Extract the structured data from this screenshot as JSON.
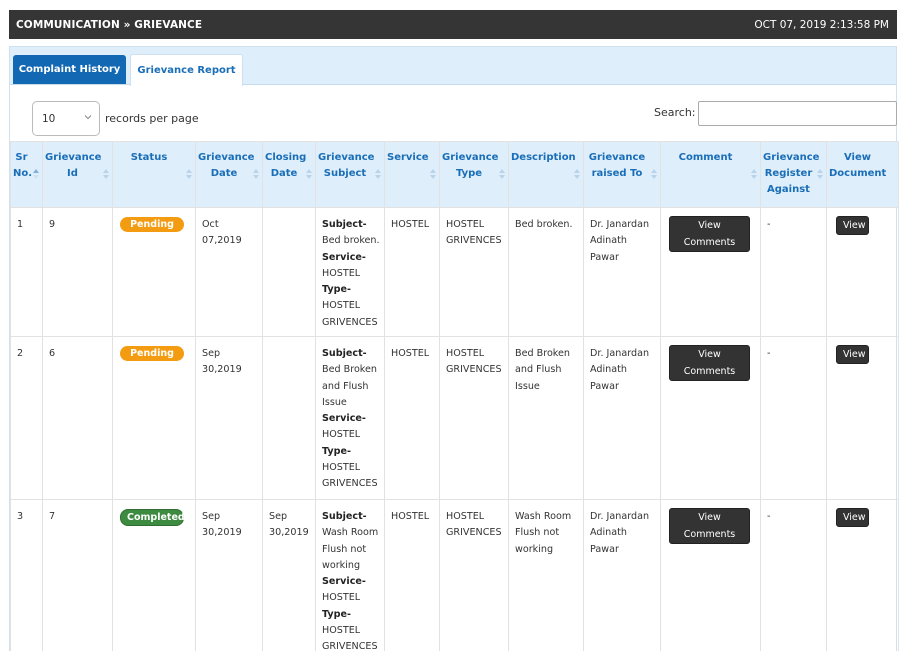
{
  "header": {
    "breadcrumb": "COMMUNICATION » GRIEVANCE",
    "datetime": "OCT 07, 2019  2:13:58 PM"
  },
  "tabs": [
    {
      "label": "Complaint History",
      "active": true
    },
    {
      "label": "Grievance Report",
      "active": false
    }
  ],
  "controls": {
    "page_length": "10",
    "records_label": "records per page",
    "search_label": "Search:",
    "search_value": ""
  },
  "columns": [
    "Sr No.",
    "Grievance Id",
    "Status",
    "Grievance Date",
    "Closing Date",
    "Grievance Subject",
    "Service",
    "Grievance Type",
    "Description",
    "Grievance raised To",
    "Comment",
    "Grievance Register Against",
    "View Document"
  ],
  "labels": {
    "subject": "Subject-",
    "service": "Service-",
    "type": "Type-",
    "view_comments": "View Comments",
    "view": "View"
  },
  "rows": [
    {
      "sr": "1",
      "id": "9",
      "status": "Pending",
      "status_color": "#f39c12",
      "date": "Oct 07,2019",
      "closing": "",
      "subject": "Bed broken.",
      "service_val": "HOSTEL",
      "type_val": "HOSTEL GRIVENCES",
      "service": "HOSTEL",
      "gtype": "HOSTEL GRIVENCES",
      "description": "Bed broken.",
      "raised_to": "Dr. Janardan Adinath Pawar",
      "against": "-"
    },
    {
      "sr": "2",
      "id": "6",
      "status": "Pending",
      "status_color": "#f39c12",
      "date": "Sep 30,2019",
      "closing": "",
      "subject": "Bed Broken and Flush Issue",
      "service_val": "HOSTEL",
      "type_val": "HOSTEL GRIVENCES",
      "service": "HOSTEL",
      "gtype": "HOSTEL GRIVENCES",
      "description": "Bed Broken and Flush Issue",
      "raised_to": "Dr. Janardan Adinath Pawar",
      "against": "-"
    },
    {
      "sr": "3",
      "id": "7",
      "status": "Completed",
      "status_color": "#3d8b40",
      "date": "Sep 30,2019",
      "closing": "Sep 30,2019",
      "subject": "Wash Room Flush not working",
      "service_val": "HOSTEL",
      "type_val": "HOSTEL GRIVENCES",
      "service": "HOSTEL",
      "gtype": "HOSTEL GRIVENCES",
      "description": "Wash Room Flush not working",
      "raised_to": "Dr. Janardan Adinath Pawar",
      "against": "-"
    }
  ]
}
